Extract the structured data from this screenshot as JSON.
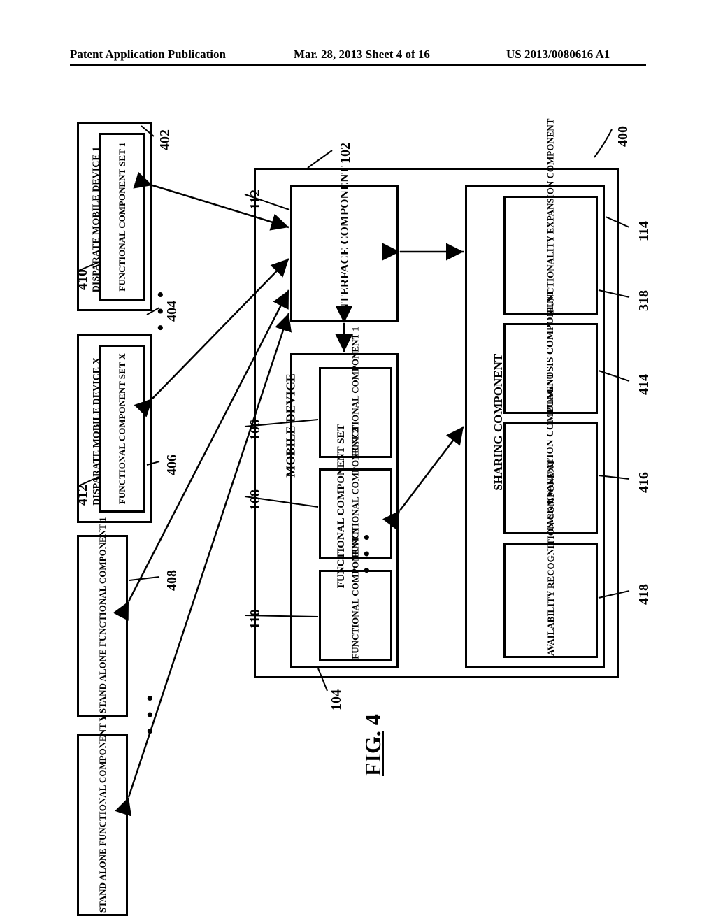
{
  "header": {
    "publication_type": "Patent Application Publication",
    "publication_date": "Mar. 28, 2013  Sheet 4 of 16",
    "publication_number": "US 2013/0080616 A1"
  },
  "figure": {
    "caption_prefix": "FIG.",
    "caption_number": "4",
    "ref_400": "400",
    "ref_402": "402",
    "ref_404": "404",
    "ref_406": "406",
    "ref_408": "408",
    "ref_410": "410",
    "ref_412": "412",
    "ref_102": "102",
    "ref_112": "112",
    "ref_104": "104",
    "ref_106": "106",
    "ref_108": "108",
    "ref_110": "110",
    "ref_114": "114",
    "ref_318": "318",
    "ref_414": "414",
    "ref_416": "416",
    "ref_418": "418"
  },
  "blocks": {
    "disparate_1": "DISPARATE MOBILE DEVICE 1",
    "fc_set_1": "FUNCTIONAL COMPONENT SET 1",
    "disparate_x": "DISPARATE MOBILE DEVICE X",
    "fc_set_x": "FUNCTIONAL COMPONENT SET X",
    "standalone_1": "STAND ALONE FUNCTIONAL COMPONENT 1",
    "standalone_y": "STAND ALONE FUNCTIONAL COMPONENT Y",
    "mobile_device": "MOBILE DEVICE",
    "interface_component": "INTERFACE COMPONENT",
    "fc_set": "FUNCTIONAL COMPONENT SET",
    "fc_1": "FUNCTIONAL COMPONENT 1",
    "fc_2": "FUNCTIONAL COMPONENT 2",
    "fc_n": "FUNCTIONAL COMPONENT N",
    "sharing": "SHARING COMPONENT",
    "func_exp": "FUNCTIONALITY EXPANSION COMPONENT",
    "diagnosis": "DIAGNOSIS COMPONENT",
    "task_eval": "TASK EVALUATION COMPONENT",
    "avail_rec": "AVAILABILITY RECOGNITION COMPONENT",
    "ellipsis": "• • •"
  }
}
